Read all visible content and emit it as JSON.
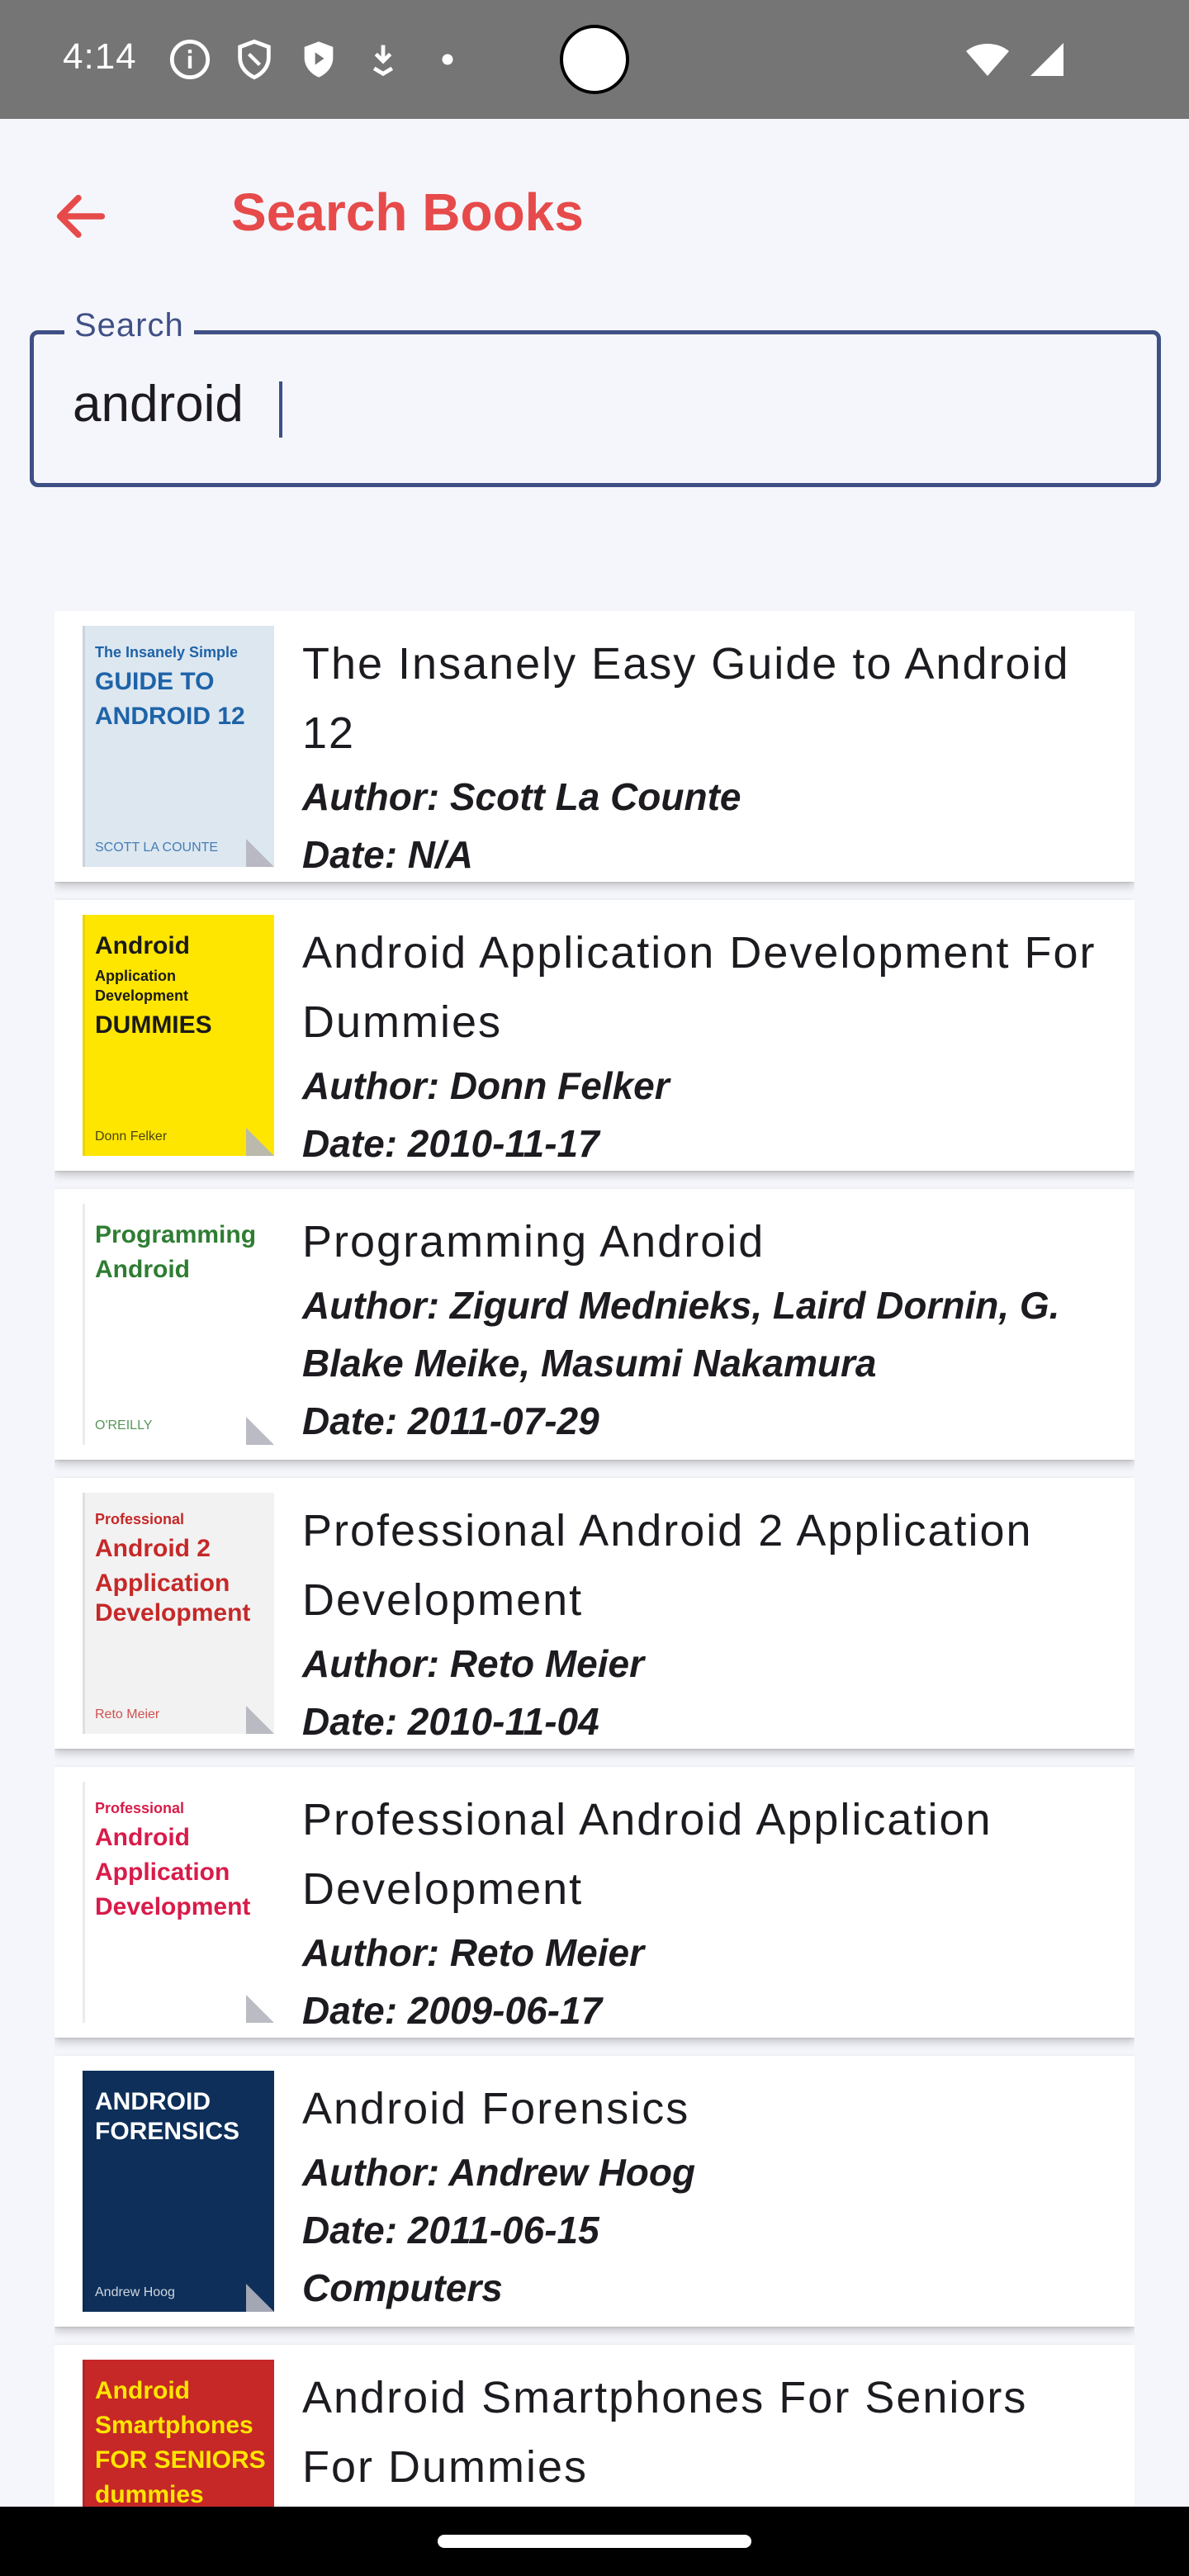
{
  "status_bar": {
    "time": "4:14",
    "icons": [
      "info-icon",
      "shield-icon",
      "play-shield-icon",
      "download-icon",
      "dot-icon"
    ],
    "right_icons": [
      "wifi-icon",
      "signal-icon"
    ]
  },
  "app_bar": {
    "title": "Search Books",
    "back_icon": "arrow-back-icon",
    "accent": "#e64a4a"
  },
  "search": {
    "label": "Search",
    "value": "android",
    "outline_color": "#3f5085"
  },
  "books": [
    {
      "title": "The Insanely Easy Guide to Android 12",
      "author": "Author: Scott La Counte",
      "date": "Date: N/A",
      "category": "",
      "cover": {
        "bg": "#dde7f0",
        "accent": "#1e63a8",
        "lines": [
          "The Insanely Simple",
          "GUIDE TO",
          "ANDROID 12"
        ],
        "footer": "SCOTT LA COUNTE"
      }
    },
    {
      "title": "Android Application Development For Dummies",
      "author": "Author: Donn Felker",
      "date": "Date: 2010-11-17",
      "category": "",
      "cover": {
        "bg": "#ffe600",
        "accent": "#1a1a1a",
        "lines": [
          "Android",
          "Application Development",
          "DUMMIES"
        ],
        "footer": "Donn Felker"
      }
    },
    {
      "title": "Programming Android",
      "author": "Author: Zigurd Mednieks, Laird Dornin, G. Blake Meike, Masumi Nakamura",
      "date": "Date: 2011-07-29",
      "category": "",
      "cover": {
        "bg": "#ffffff",
        "accent": "#2e7d32",
        "lines": [
          "Programming",
          "Android"
        ],
        "footer": "O'REILLY"
      }
    },
    {
      "title": "Professional Android 2 Application Development",
      "author": "Author: Reto Meier",
      "date": "Date: 2010-11-04",
      "category": "",
      "cover": {
        "bg": "#f2f2f2",
        "accent": "#c62828",
        "lines": [
          "Professional",
          "Android 2",
          "Application Development"
        ],
        "footer": "Reto Meier"
      }
    },
    {
      "title": "Professional Android Application Development",
      "author": "Author: Reto Meier",
      "date": "Date: 2009-06-17",
      "category": "",
      "cover": {
        "bg": "#ffffff",
        "accent": "#d81b4a",
        "lines": [
          "Professional",
          "Android",
          "Application",
          "Development"
        ],
        "footer": ""
      }
    },
    {
      "title": "Android Forensics",
      "author": "Author: Andrew Hoog",
      "date": "Date: 2011-06-15",
      "category": "Computers",
      "cover": {
        "bg": "#0d2f5a",
        "accent": "#ffffff",
        "lines": [
          "ANDROID FORENSICS"
        ],
        "footer": "Andrew Hoog"
      }
    },
    {
      "title": "Android Smartphones For Seniors For Dummies",
      "author": "",
      "date": "",
      "category": "",
      "cover": {
        "bg": "#c62828",
        "accent": "#ffe600",
        "lines": [
          "Android",
          "Smartphones",
          "FOR SENIORS",
          "dummies"
        ],
        "footer": ""
      }
    }
  ]
}
